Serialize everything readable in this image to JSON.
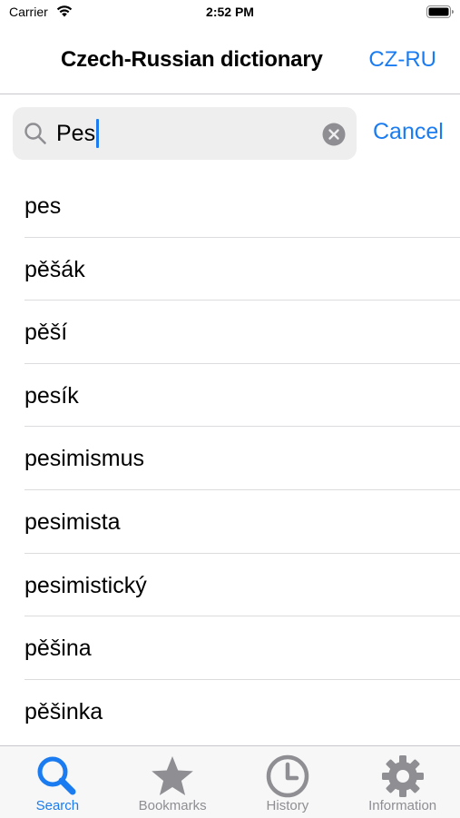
{
  "status_bar": {
    "carrier": "Carrier",
    "time": "2:52 PM"
  },
  "nav": {
    "title": "Czech-Russian dictionary",
    "lang_button": "CZ-RU"
  },
  "search": {
    "value": "Pes",
    "cancel_label": "Cancel"
  },
  "results": [
    "pes",
    "pěšák",
    "pěší",
    "pesík",
    "pesimismus",
    "pesimista",
    "pesimistický",
    "pěšina",
    "pěšinka"
  ],
  "tabs": [
    {
      "label": "Search",
      "icon": "search-icon",
      "active": true
    },
    {
      "label": "Bookmarks",
      "icon": "star-icon",
      "active": false
    },
    {
      "label": "History",
      "icon": "clock-icon",
      "active": false
    },
    {
      "label": "Information",
      "icon": "gear-icon",
      "active": false
    }
  ],
  "colors": {
    "accent": "#1a7cf0",
    "inactive_tab": "#8e8e93"
  }
}
